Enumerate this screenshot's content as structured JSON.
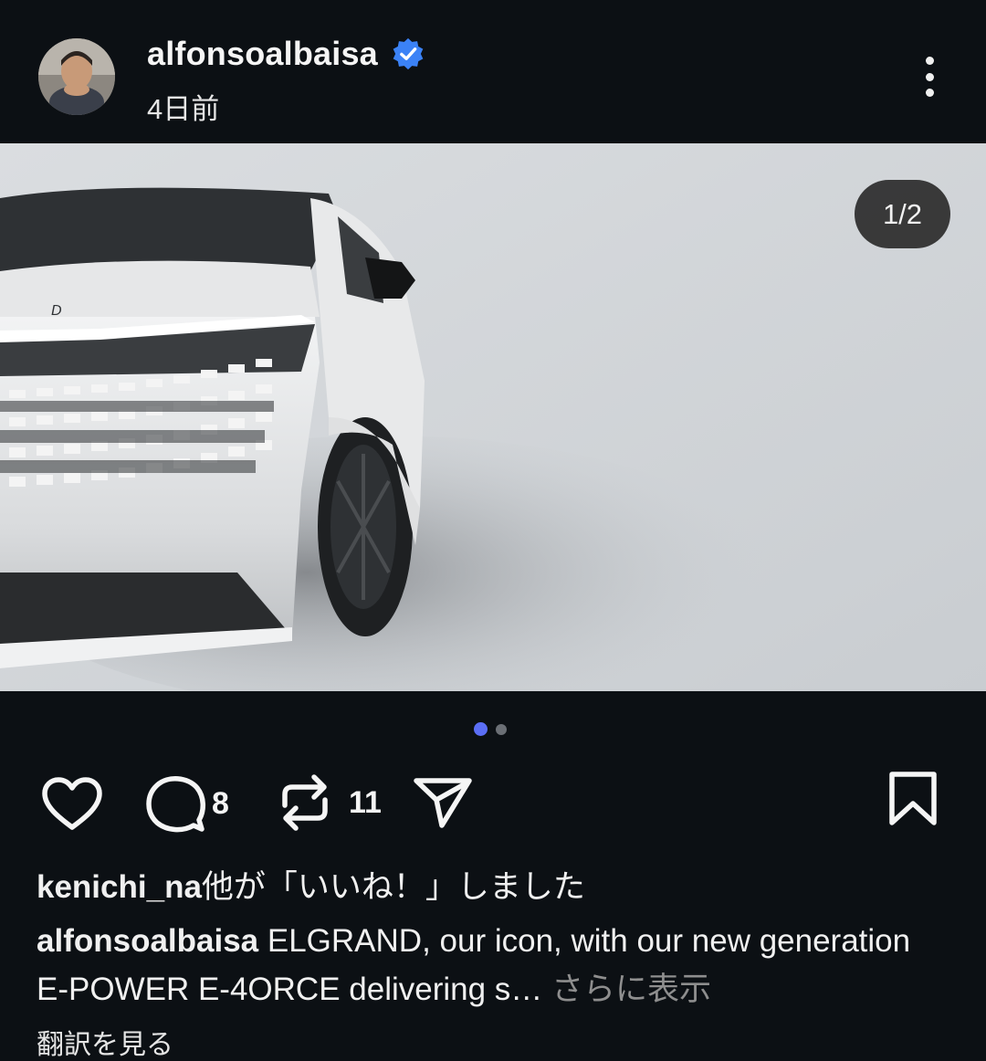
{
  "header": {
    "username": "alfonsoalbaisa",
    "timestamp": "4日前",
    "verified_icon": "verified-badge-icon",
    "more_icon": "more-vertical-icon"
  },
  "media": {
    "counter": "1/2",
    "current_slide": 1,
    "total_slides": 2,
    "badge_text": "D"
  },
  "actions": {
    "like_icon": "heart-icon",
    "comment_icon": "comment-icon",
    "comment_count": "8",
    "repost_icon": "repost-icon",
    "repost_count": "11",
    "share_icon": "send-icon",
    "save_icon": "bookmark-icon"
  },
  "likes": {
    "user": "kenichi_na",
    "suffix": "他が「いいね！」しました"
  },
  "caption": {
    "author": "alfonsoalbaisa",
    "text": " ELGRAND, our icon, with our new generation E-POWER E-4ORCE delivering s…",
    "more_label": " さらに表示"
  },
  "translate_label": "翻訳を見る",
  "colors": {
    "background": "#0c1014",
    "verified": "#3b82f6",
    "active_dot": "#5b6ef5",
    "inactive_dot": "#6b6f75",
    "muted_text": "#8e8e8e"
  }
}
